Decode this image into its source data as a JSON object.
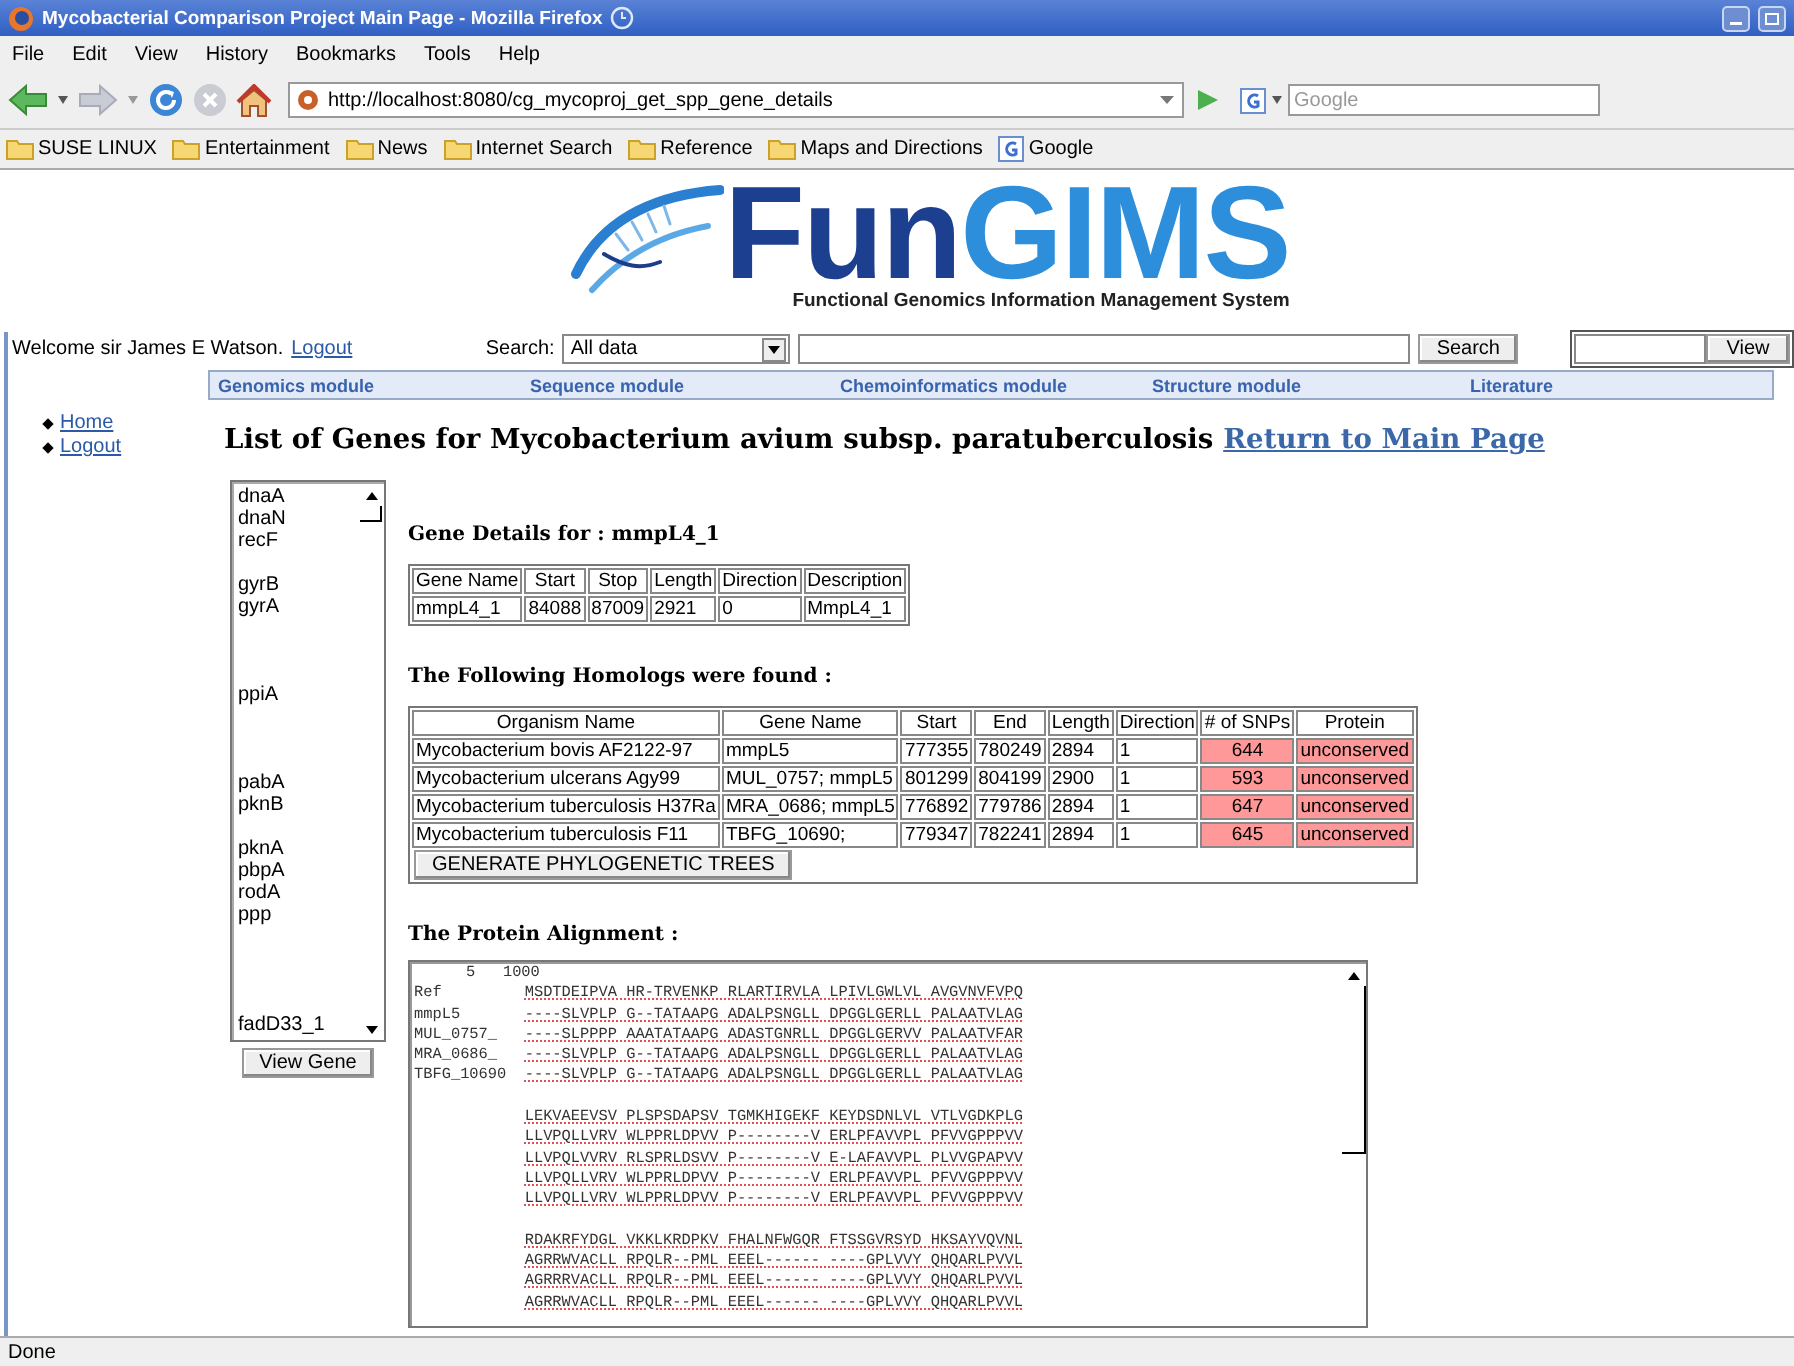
{
  "window": {
    "title": "Mycobacterial Comparison Project Main Page - Mozilla Firefox"
  },
  "menu": [
    "File",
    "Edit",
    "View",
    "History",
    "Bookmarks",
    "Tools",
    "Help"
  ],
  "toolbar": {
    "url": "http://localhost:8080/cg_mycoproj_get_spp_gene_details",
    "search_placeholder": "Google"
  },
  "bookmarks": [
    {
      "label": "SUSE LINUX",
      "kind": "folder"
    },
    {
      "label": "Entertainment",
      "kind": "folder"
    },
    {
      "label": "News",
      "kind": "folder"
    },
    {
      "label": "Internet Search",
      "kind": "folder"
    },
    {
      "label": "Reference",
      "kind": "folder"
    },
    {
      "label": "Maps and Directions",
      "kind": "folder"
    },
    {
      "label": "Google",
      "kind": "google"
    }
  ],
  "logo": {
    "part_1": "Fun",
    "part_2": "GIMS",
    "subtitle": "Functional Genomics Information Management System"
  },
  "user_bar": {
    "welcome": "Welcome sir James E Watson.",
    "logout": "Logout",
    "search_label": "Search:",
    "search_scope": "All data",
    "search_button": "Search",
    "view_button": "View"
  },
  "modules": [
    "Genomics module",
    "Sequence module",
    "Chemoinformatics module",
    "Structure module",
    "Literature"
  ],
  "sidebar": {
    "items": [
      "Home",
      "Logout"
    ]
  },
  "heading": {
    "title": "List of Genes for Mycobacterium avium subsp. paratuberculosis",
    "link": "Return to Main Page"
  },
  "gene_list": {
    "groups": [
      [
        "dnaA",
        "dnaN",
        "recF"
      ],
      [
        "gyrB",
        "gyrA"
      ],
      [
        "ppiA"
      ],
      [
        "pabA",
        "pknB"
      ],
      [
        "pknA",
        "pbpA",
        "rodA",
        "ppp"
      ],
      [
        "fadD33_1"
      ]
    ],
    "button": "View Gene"
  },
  "gene_details": {
    "title": "Gene Details for : mmpL4_1",
    "columns": [
      "Gene Name",
      "Start",
      "Stop",
      "Length",
      "Direction",
      "Description"
    ],
    "row": [
      "mmpL4_1",
      "84088",
      "87009",
      "2921",
      "0",
      "MmpL4_1"
    ]
  },
  "homologs": {
    "title": "The Following Homologs were found :",
    "columns": [
      "Organism Name",
      "Gene Name",
      "Start",
      "End",
      "Length",
      "Direction",
      "# of SNPs",
      "Protein"
    ],
    "rows": [
      {
        "cells": [
          "Mycobacterium  bovis AF2122-97",
          "mmpL5",
          "777355",
          "780249",
          "2894",
          "1",
          "644",
          "unconserved"
        ],
        "conserved": false
      },
      {
        "cells": [
          "Mycobacterium  ulcerans Agy99",
          "MUL_0757; mmpL5",
          "801299",
          "804199",
          "2900",
          "1",
          "593",
          "unconserved"
        ],
        "conserved": false
      },
      {
        "cells": [
          "Mycobacterium  tuberculosis H37Ra",
          "MRA_0686; mmpL5",
          "776892",
          "779786",
          "2894",
          "1",
          "647",
          "unconserved"
        ],
        "conserved": false
      },
      {
        "cells": [
          "Mycobacterium  tuberculosis F11",
          "TBFG_10690;",
          "779347",
          "782241",
          "2894",
          "1",
          "645",
          "unconserved"
        ],
        "conserved": false
      }
    ],
    "button": "GENERATE PHYLOGENETIC TREES"
  },
  "alignment": {
    "title": "The Protein Alignment :",
    "header": "5   1000",
    "blocks": [
      {
        "rows": [
          {
            "label": "Ref",
            "sequence": "MSDTDEIPVA HR-TRVENKP RLARTIRVLA LPIVLGWLVL AVGVNVFVPQ"
          },
          {
            "label": "mmpL5",
            "sequence": "----SLVPLP G--TATAAPG ADALPSNGLL DPGGLGERLL PALAATVLAG"
          },
          {
            "label": "MUL_0757_",
            "sequence": "----SLPPPP AAATATAAPG ADASTGNRLL DPGGLGERVV PALAATVFAR"
          },
          {
            "label": "MRA_0686_",
            "sequence": "----SLVPLP G--TATAAPG ADALPSNGLL DPGGLGERLL PALAATVLAG"
          },
          {
            "label": "TBFG_10690",
            "sequence": "----SLVPLP G--TATAAPG ADALPSNGLL DPGGLGERLL PALAATVLAG"
          }
        ]
      },
      {
        "rows": [
          {
            "sequence": "LEKVAEEVSV PLSPSDAPSV TGMKHIGEKF KEYDSDNLVL VTLVGDKPLG"
          },
          {
            "sequence": "LLVPQLLVRV WLPPRLDPVV P--------V ERLPFAVVPL PFVVGPPPVV"
          },
          {
            "sequence": "LLVPQLVVRV RLSPRLDSVV P--------V E-LAFAVVPL PLVVGPAPVV"
          },
          {
            "sequence": "LLVPQLLVRV WLPPRLDPVV P--------V ERLPFAVVPL PFVVGPPPVV"
          },
          {
            "sequence": "LLVPQLLVRV WLPPRLDPVV P--------V ERLPFAVVPL PFVVGPPPVV"
          }
        ]
      },
      {
        "rows": [
          {
            "sequence": "RDAKRFYDGL VKKLKRDPKV FHALNFWGQR FTSSGVRSYD HKSAYVQVNL"
          },
          {
            "sequence": "AGRRWVACLL RPQLR--PML EEEL------ ----GPLVVY QHQARLPVVL"
          },
          {
            "sequence": "AGRRRVACLL RPQLR--PML EEEL------ ----GPLVVY QHQARLPVVL"
          },
          {
            "sequence": "AGRRWVACLL RPQLR--PML EEEL------ ----GPLVVY QHQARLPVVL"
          }
        ]
      }
    ]
  },
  "status_bar": {
    "text": "Done"
  }
}
